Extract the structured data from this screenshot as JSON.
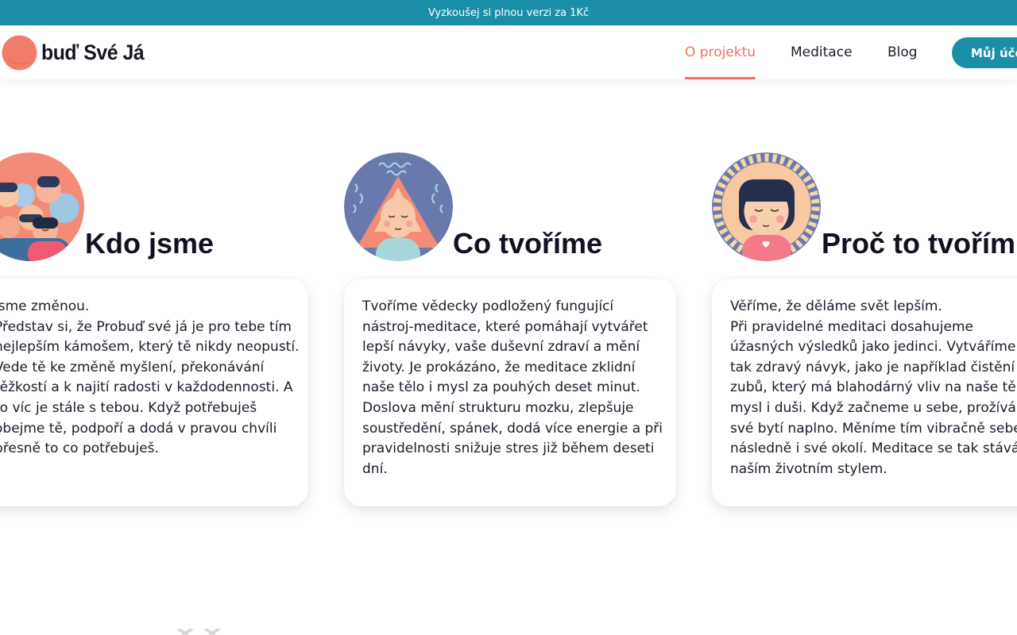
{
  "promo": {
    "text": "Vyzkoušej si plnou verzi za 1Kč"
  },
  "header": {
    "logo_text": "buď Své Já",
    "nav": [
      {
        "label": "O projektu",
        "active": true
      },
      {
        "label": "Meditace",
        "active": false
      },
      {
        "label": "Blog",
        "active": false
      }
    ],
    "account_button": "Můj úče"
  },
  "colors": {
    "accent": "#ef7360",
    "brand": "#1c8fa8",
    "text": "#1b1b2a"
  },
  "sections": [
    {
      "title": "Kdo jsme",
      "icon": "group-of-people-illustration",
      "lines": [
        "jsme změnou.",
        "Představ si, že Probuď své já je pro tebe tím",
        "nejlepším kámošem, který tě nikdy neopustí.",
        "Vede tě ke změně myšlení, překonávání",
        "těžkostí a k najití radosti v každodennosti. A",
        "to víc je stále s tebou. Když potřebuješ",
        "obejme tě, podpoří a dodá v pravou chvíli",
        "přesně to co potřebuješ."
      ]
    },
    {
      "title": "Co tvoříme",
      "icon": "meditating-woman-illustration",
      "lines": [
        "Tvoříme vědecky podložený fungující",
        "nástroj-meditace, které pomáhají vytvářet",
        "lepší návyky, vaše duševní zdraví a mění",
        "životy. Je prokázáno, že meditace zklidní",
        "naše tělo i mysl za pouhých deset minut.",
        "Doslova mění strukturu mozku, zlepšuje",
        "soustředění, spánek, dodá více energie a při",
        "pravidelnosti snižuje stres již během deseti",
        "dní."
      ]
    },
    {
      "title": "Proč to tvořím",
      "icon": "sun-girl-illustration",
      "lines": [
        "Věříme, že děláme svět lepším.",
        "Při pravidelné meditaci dosahujeme",
        "úžasných výsledků jako jedinci. Vytváříme si",
        "tak zdravý návyk, jako je například čistění",
        "zubů, který má blahodárný vliv na naše tělo",
        "mysl i duši. Když začneme u sebe, prožíváme",
        "své bytí naplno. Měníme tím vibračně sebe a",
        "následně i své okolí. Meditace se tak stává",
        "naším životním stylem."
      ]
    }
  ]
}
